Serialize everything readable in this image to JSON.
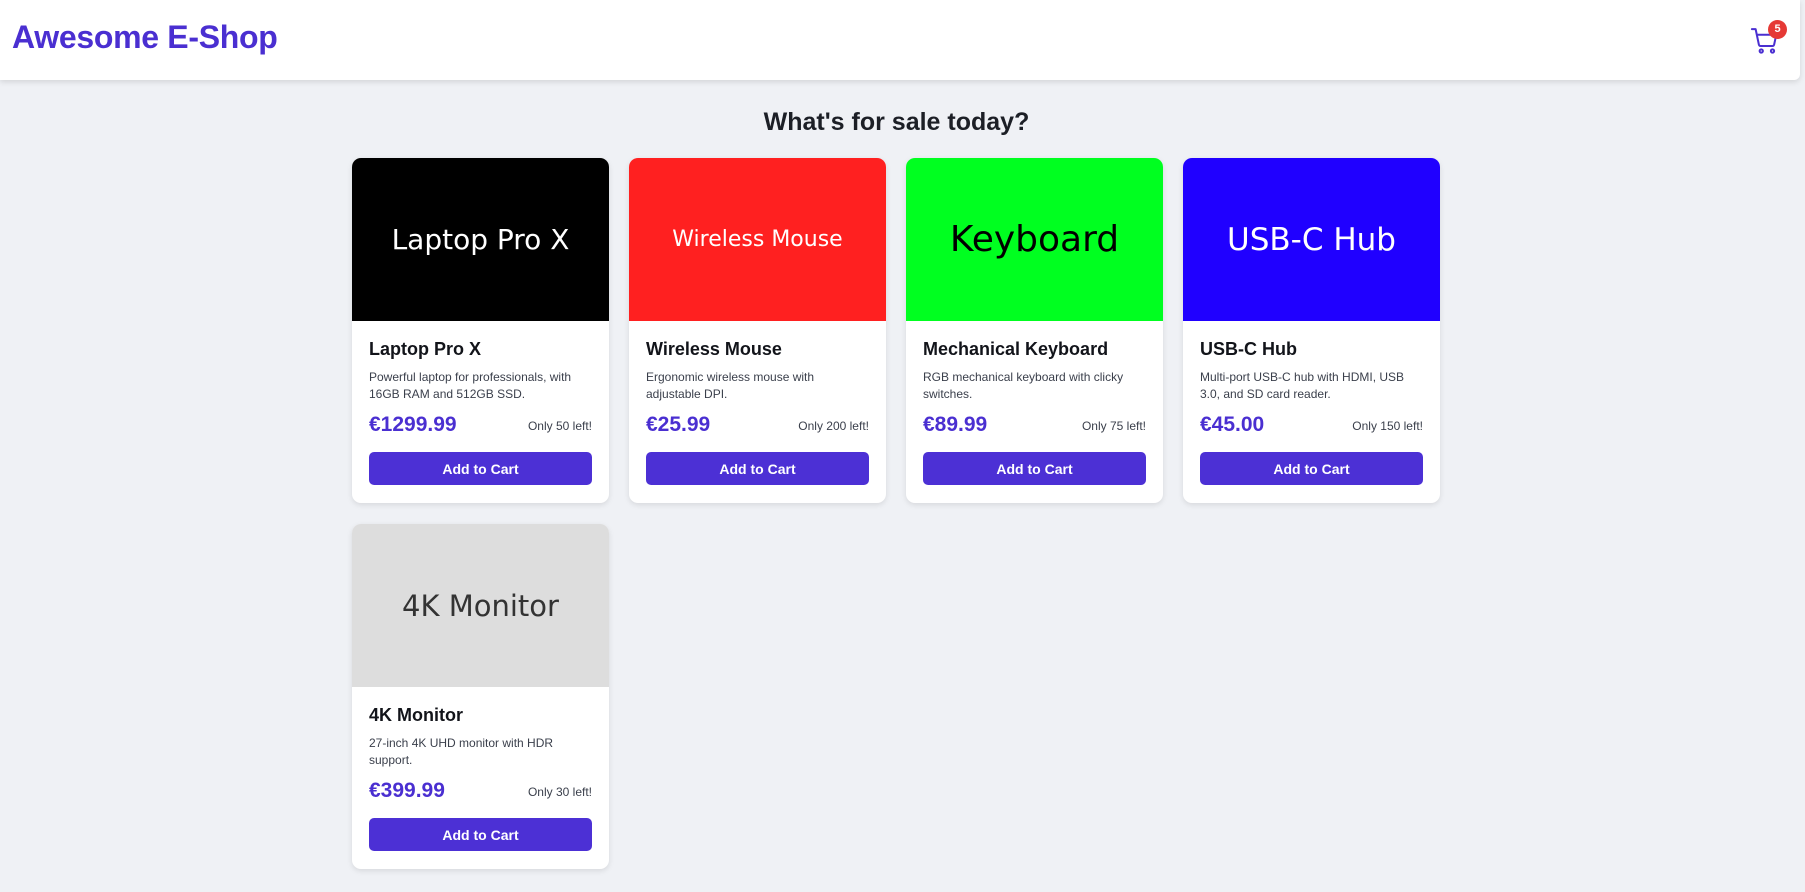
{
  "header": {
    "brand": "Awesome E-Shop",
    "cart_count": "5",
    "cart_icon": "shopping-cart-icon"
  },
  "page_title": "What's for sale today?",
  "products": [
    {
      "image_text": "Laptop Pro X",
      "image_bg": "#000000",
      "image_fg": "#ffffff",
      "name": "Laptop Pro X",
      "description": "Powerful laptop for professionals, with 16GB RAM and 512GB SSD.",
      "price": "€1299.99",
      "stock": "Only 50 left!",
      "button": "Add to Cart"
    },
    {
      "image_text": "Wireless Mouse",
      "image_bg": "#ff2020",
      "image_fg": "#ffffff",
      "name": "Wireless Mouse",
      "description": "Ergonomic wireless mouse with adjustable DPI.",
      "price": "€25.99",
      "stock": "Only 200 left!",
      "button": "Add to Cart"
    },
    {
      "image_text": "Keyboard",
      "image_bg": "#00ff20",
      "image_fg": "#000000",
      "name": "Mechanical Keyboard",
      "description": "RGB mechanical keyboard with clicky switches.",
      "price": "€89.99",
      "stock": "Only 75 left!",
      "button": "Add to Cart"
    },
    {
      "image_text": "USB-C Hub",
      "image_bg": "#2000ff",
      "image_fg": "#ffffff",
      "name": "USB-C Hub",
      "description": "Multi-port USB-C hub with HDMI, USB 3.0, and SD card reader.",
      "price": "€45.00",
      "stock": "Only 150 left!",
      "button": "Add to Cart"
    },
    {
      "image_text": "4K Monitor",
      "image_bg": "#dddddd",
      "image_fg": "#333333",
      "name": "4K Monitor",
      "description": "27-inch 4K UHD monitor with HDR support.",
      "price": "€399.99",
      "stock": "Only 30 left!",
      "button": "Add to Cart"
    }
  ]
}
